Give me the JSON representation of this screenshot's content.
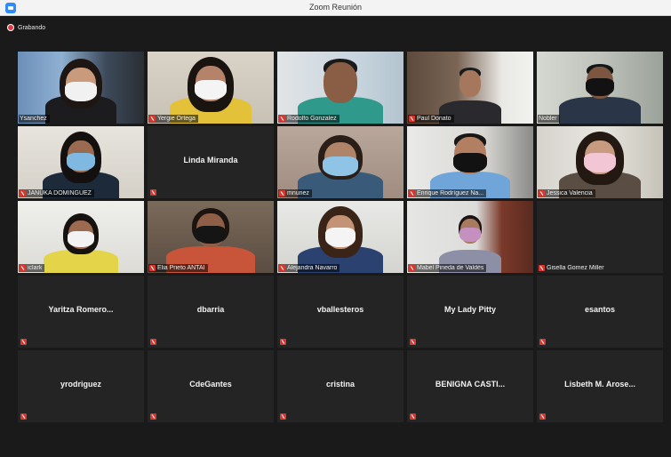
{
  "window": {
    "title": "Zoom Reunión"
  },
  "recording": {
    "label": "Grabando"
  },
  "colors": {
    "active_speaker": "#a6d23a",
    "muted": "#d8382f",
    "tile_bg": "#242424"
  },
  "participants": [
    {
      "name": "Ysanchez",
      "video": true
    },
    {
      "name": "Yergie Ortega",
      "video": true
    },
    {
      "name": "Rodolfo Gonzalez",
      "video": true
    },
    {
      "name": "Paul Donato",
      "video": true
    },
    {
      "name": "Nobler",
      "video": true,
      "active": true
    },
    {
      "name": "JANUKA DOMINGUEZ",
      "video": true
    },
    {
      "name": "Linda Miranda",
      "video": false
    },
    {
      "name": "mnunez",
      "video": true
    },
    {
      "name": "Enrique Rodríguez Na...",
      "video": true
    },
    {
      "name": "Jessica Valencia",
      "video": true
    },
    {
      "name": "iclark",
      "video": true
    },
    {
      "name": "Elia Prieto ANTAI",
      "video": true
    },
    {
      "name": "Alejandra Navarro",
      "video": true
    },
    {
      "name": "Mabel Pineda de Valdés",
      "video": true
    },
    {
      "name": "Gisella Gomez Miller",
      "video": false,
      "label_only": true
    },
    {
      "name": "Yaritza Romero...",
      "video": false
    },
    {
      "name": "dbarria",
      "video": false
    },
    {
      "name": "vballesteros",
      "video": false
    },
    {
      "name": "My Lady Pitty",
      "video": false
    },
    {
      "name": "esantos",
      "video": false
    },
    {
      "name": "yrodriguez",
      "video": false
    },
    {
      "name": "CdeGantes",
      "video": false
    },
    {
      "name": "cristina",
      "video": false
    },
    {
      "name": "BENIGNA CASTI...",
      "video": false
    },
    {
      "name": "Lisbeth M. Arose...",
      "video": false
    }
  ]
}
